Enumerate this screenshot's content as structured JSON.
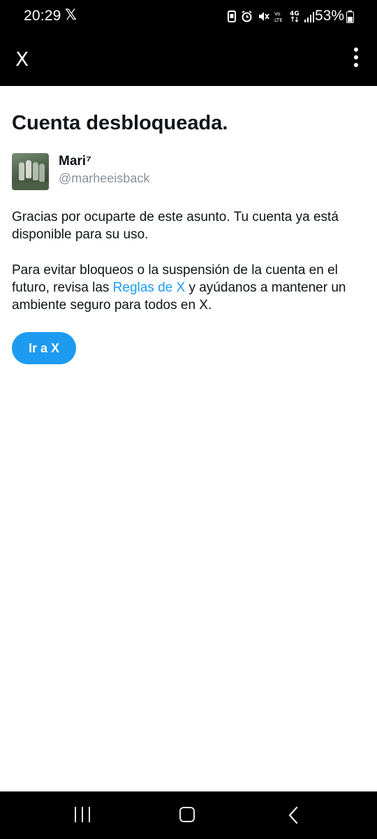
{
  "status_bar": {
    "time": "20:29",
    "app_icon": "𝕏",
    "battery": "53%"
  },
  "app_bar": {
    "title": "X"
  },
  "main": {
    "title": "Cuenta desbloqueada.",
    "user": {
      "name": "Mari⁷",
      "handle": "@marheeisback"
    },
    "paragraph1": "Gracias por ocuparte de este asunto. Tu cuenta ya está disponible para su uso.",
    "paragraph2_before": "Para evitar bloqueos o la suspensión de la cuenta en el futuro, revisa las ",
    "paragraph2_link": "Reglas de X",
    "paragraph2_after": " y ayúdanos a mantener un ambiente seguro para todos en X.",
    "button_label": "Ir a X"
  },
  "colors": {
    "accent": "#1d9bf0",
    "text": "#0f1419",
    "secondary_text": "#8a9298",
    "bars": "#000000"
  },
  "icons": {
    "status": [
      "save-icon",
      "alarm-icon",
      "mute-icon",
      "volte-icon",
      "4g-icon",
      "signal-icon",
      "battery-icon"
    ],
    "app_bar": [
      "more-vertical-icon"
    ],
    "nav": [
      "recents-icon",
      "home-icon",
      "back-icon"
    ]
  }
}
